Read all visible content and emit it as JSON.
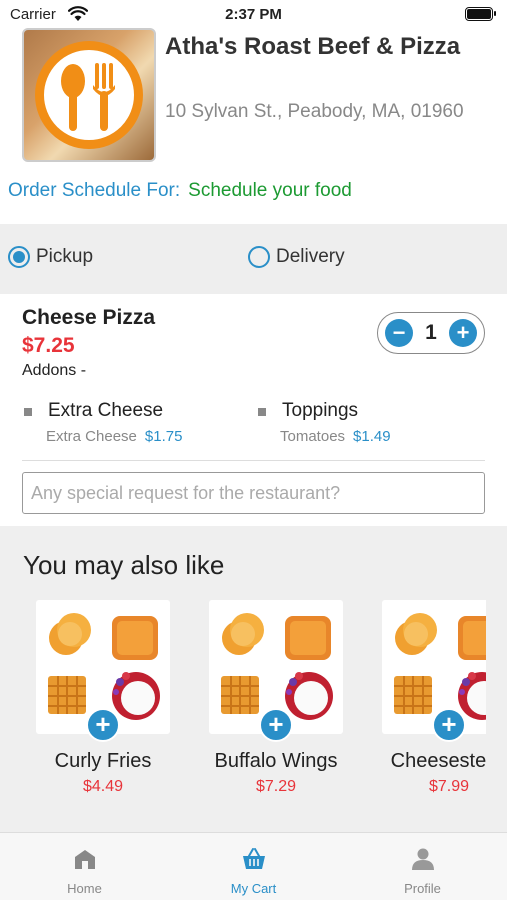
{
  "status_bar": {
    "carrier": "Carrier",
    "time": "2:37 PM"
  },
  "restaurant": {
    "name": "Atha's Roast Beef & Pizza",
    "address": "10 Sylvan St., Peabody, MA, 01960"
  },
  "schedule": {
    "label": "Order Schedule For:",
    "value": "Schedule your food"
  },
  "order_mode": {
    "options": [
      "Pickup",
      "Delivery"
    ],
    "selected": "Pickup"
  },
  "cart_item": {
    "name": "Cheese Pizza",
    "price": "$7.25",
    "addons_label": "Addons -",
    "quantity": "1",
    "addons": [
      {
        "title": "Extra Cheese",
        "detail": "Extra Cheese",
        "price": "$1.75"
      },
      {
        "title": "Toppings",
        "detail": "Tomatoes",
        "price": "$1.49"
      }
    ],
    "special_request_placeholder": "Any special request for the restaurant?"
  },
  "suggestions": {
    "title": "You may also like",
    "items": [
      {
        "name": "Curly Fries",
        "price": "$4.49"
      },
      {
        "name": "Buffalo Wings",
        "price": "$7.29"
      },
      {
        "name": "Cheesesteak",
        "price": "$7.99"
      }
    ]
  },
  "tabbar": {
    "tabs": [
      {
        "label": "Home",
        "icon": "home-icon"
      },
      {
        "label": "My Cart",
        "icon": "cart-icon"
      },
      {
        "label": "Profile",
        "icon": "profile-icon"
      }
    ],
    "active": "My Cart"
  },
  "colors": {
    "accent": "#2a8fc8",
    "price": "#e8343a",
    "schedule_value": "#1c9a32",
    "logo_orange": "#f18e16"
  }
}
